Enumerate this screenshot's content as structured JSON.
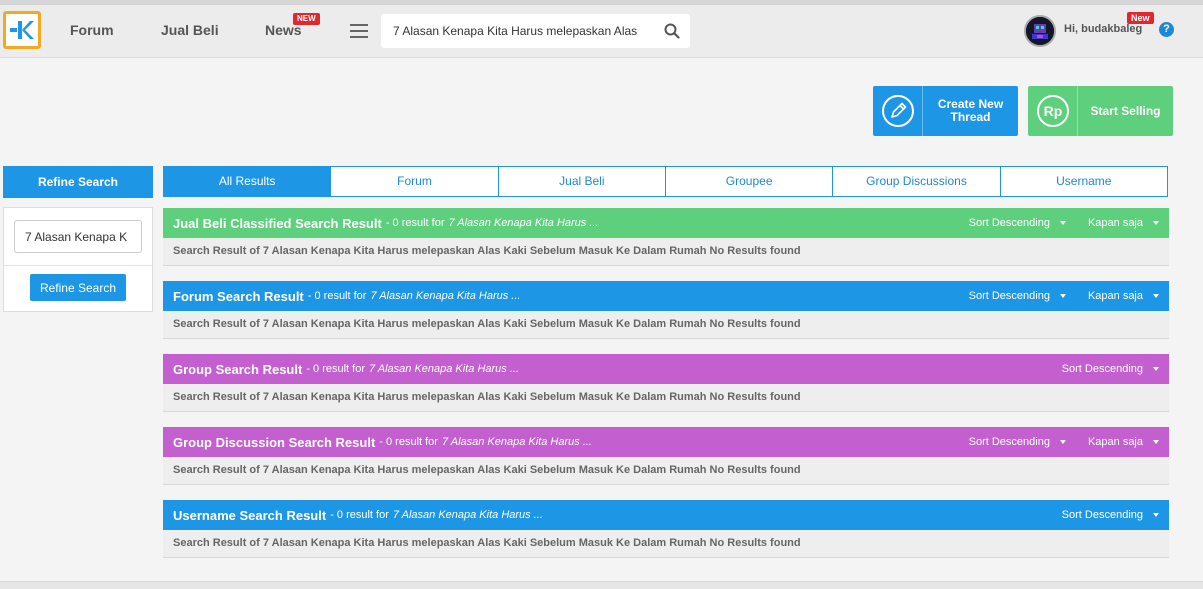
{
  "header": {
    "logo_text": "K",
    "nav": [
      {
        "label": "Forum"
      },
      {
        "label": "Jual Beli"
      },
      {
        "label": "News",
        "badge": "NEW"
      }
    ],
    "search_value": "7 Alasan Kenapa Kita Harus melepaskan Alas",
    "greeting": "Hi, budakbaleg",
    "greeting_badge": "New",
    "help": "?"
  },
  "actions": {
    "create_thread": "Create New Thread",
    "start_selling": "Start Selling",
    "rp_icon_text": "Rp"
  },
  "refine": {
    "heading": "Refine Search",
    "input_value": "7 Alasan Kenapa K",
    "button": "Refine Search"
  },
  "tabs": [
    {
      "label": "All Results",
      "active": true
    },
    {
      "label": "Forum"
    },
    {
      "label": "Jual Beli"
    },
    {
      "label": "Groupee"
    },
    {
      "label": "Group Discussions"
    },
    {
      "label": "Username"
    }
  ],
  "sections": [
    {
      "title": "Jual Beli Classified Search Result",
      "count": "- 0 result for",
      "query": "7 Alasan Kenapa Kita Harus ...",
      "sort": "Sort Descending",
      "time": "Kapan saja",
      "color": "#5dcf7d",
      "body": "Search Result of 7 Alasan Kenapa Kita Harus melepaskan Alas Kaki Sebelum Masuk Ke Dalam Rumah No Results found"
    },
    {
      "title": "Forum Search Result",
      "count": "- 0 result for",
      "query": "7 Alasan Kenapa Kita Harus ...",
      "sort": "Sort Descending",
      "time": "Kapan saja",
      "color": "#1e96e6",
      "body": "Search Result of 7 Alasan Kenapa Kita Harus melepaskan Alas Kaki Sebelum Masuk Ke Dalam Rumah No Results found"
    },
    {
      "title": "Group Search Result",
      "count": "- 0 result for",
      "query": "7 Alasan Kenapa Kita Harus ...",
      "sort": "Sort Descending",
      "color": "#c35fcf",
      "body": "Search Result of 7 Alasan Kenapa Kita Harus melepaskan Alas Kaki Sebelum Masuk Ke Dalam Rumah No Results found"
    },
    {
      "title": "Group Discussion Search Result",
      "count": "- 0 result for",
      "query": "7 Alasan Kenapa Kita Harus ...",
      "sort": "Sort Descending",
      "time": "Kapan saja",
      "color": "#c35fcf",
      "body": "Search Result of 7 Alasan Kenapa Kita Harus melepaskan Alas Kaki Sebelum Masuk Ke Dalam Rumah No Results found"
    },
    {
      "title": "Username Search Result",
      "count": "- 0 result for",
      "query": "7 Alasan Kenapa Kita Harus ...",
      "sort": "Sort Descending",
      "color": "#1e96e6",
      "body": "Search Result of 7 Alasan Kenapa Kita Harus melepaskan Alas Kaki Sebelum Masuk Ke Dalam Rumah No Results found"
    }
  ],
  "icons": {
    "logo": "kaskus-logo-icon",
    "menu": "hamburger-menu-icon",
    "search": "search-icon",
    "pencil": "pencil-icon",
    "rupiah": "rupiah-icon",
    "help": "help-icon",
    "caret": "caret-down-icon"
  }
}
